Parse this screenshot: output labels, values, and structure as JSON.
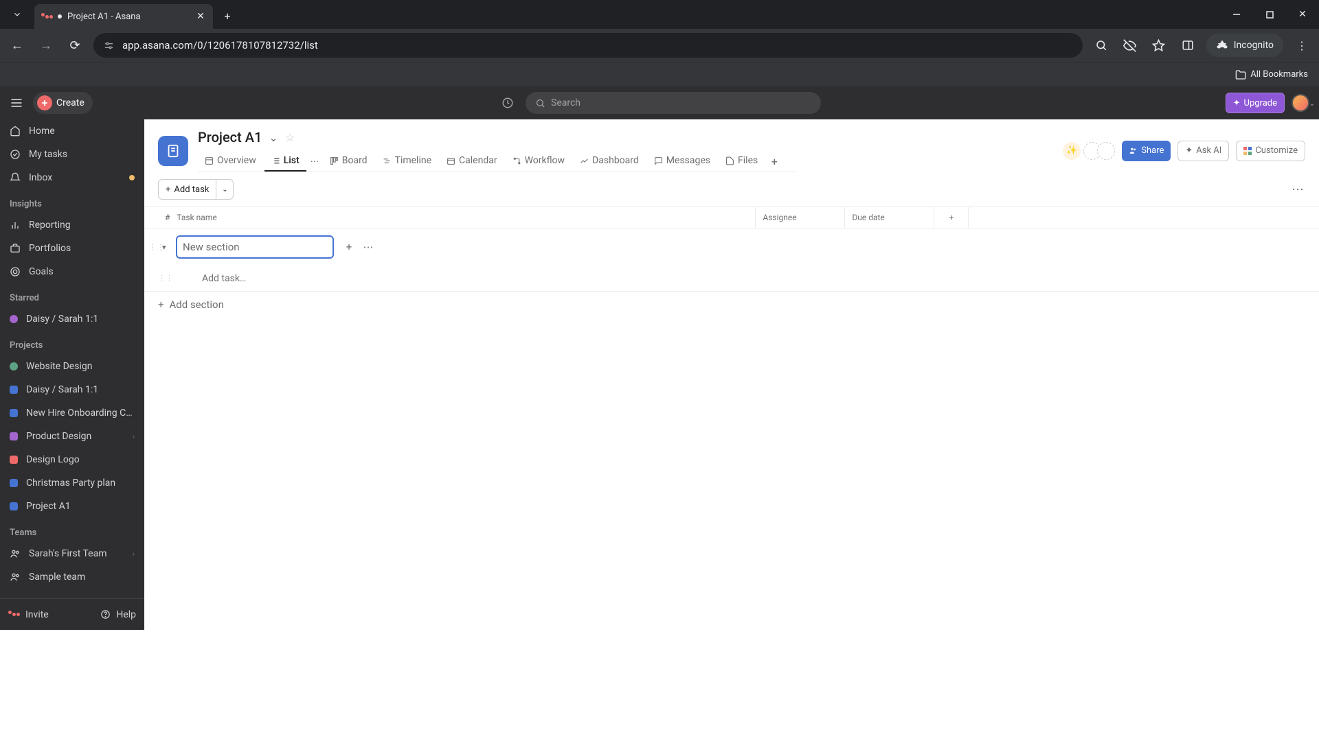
{
  "browser": {
    "tab_title": "Project A1 - Asana",
    "url": "app.asana.com/0/1206178107812732/list",
    "incognito_label": "Incognito",
    "bookmarks_label": "All Bookmarks"
  },
  "topbar": {
    "create_label": "Create",
    "search_placeholder": "Search",
    "upgrade_label": "Upgrade"
  },
  "sidebar": {
    "nav": {
      "home": "Home",
      "my_tasks": "My tasks",
      "inbox": "Inbox"
    },
    "insights_label": "Insights",
    "insights": {
      "reporting": "Reporting",
      "portfolios": "Portfolios",
      "goals": "Goals"
    },
    "starred_label": "Starred",
    "starred": [
      {
        "label": "Daisy / Sarah 1:1",
        "shape": "circle",
        "color": "#a366cc"
      }
    ],
    "projects_label": "Projects",
    "projects": [
      {
        "label": "Website Design",
        "shape": "circle",
        "color": "#5da283"
      },
      {
        "label": "Daisy / Sarah 1:1",
        "shape": "square",
        "color": "#4573d2"
      },
      {
        "label": "New Hire Onboarding Ch…",
        "shape": "square",
        "color": "#4573d2"
      },
      {
        "label": "Product Design",
        "shape": "square",
        "color": "#a366cc",
        "expandable": true
      },
      {
        "label": "Design Logo",
        "shape": "square",
        "color": "#f06a6a"
      },
      {
        "label": "Christmas Party plan",
        "shape": "square",
        "color": "#4573d2"
      },
      {
        "label": "Project A1",
        "shape": "square",
        "color": "#4573d2"
      }
    ],
    "teams_label": "Teams",
    "teams": [
      {
        "label": "Sarah's First Team",
        "expandable": true
      },
      {
        "label": "Sample team"
      }
    ],
    "invite_label": "Invite",
    "help_label": "Help"
  },
  "project": {
    "title": "Project A1",
    "tabs": [
      {
        "key": "overview",
        "label": "Overview"
      },
      {
        "key": "list",
        "label": "List",
        "active": true
      },
      {
        "key": "board",
        "label": "Board"
      },
      {
        "key": "timeline",
        "label": "Timeline"
      },
      {
        "key": "calendar",
        "label": "Calendar"
      },
      {
        "key": "workflow",
        "label": "Workflow"
      },
      {
        "key": "dashboard",
        "label": "Dashboard"
      },
      {
        "key": "messages",
        "label": "Messages"
      },
      {
        "key": "files",
        "label": "Files"
      }
    ],
    "share_label": "Share",
    "ask_ai_label": "Ask AI",
    "customize_label": "Customize",
    "add_task_label": "Add task",
    "columns": {
      "id": "#",
      "name": "Task name",
      "assignee": "Assignee",
      "due": "Due date"
    },
    "section_placeholder": "New section",
    "add_task_placeholder": "Add task…",
    "add_section_label": "Add section"
  }
}
